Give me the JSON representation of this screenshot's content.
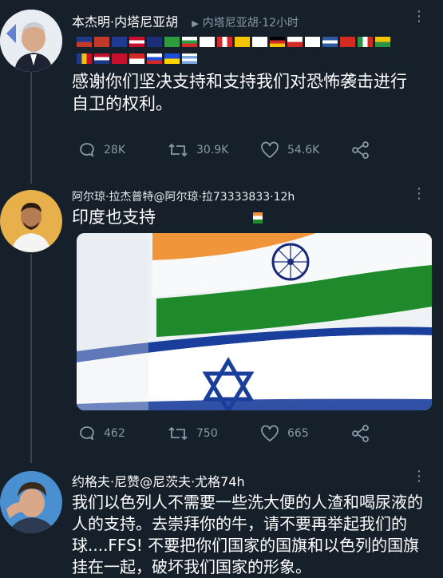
{
  "tweet1": {
    "name": "本杰明·内塔尼亚胡",
    "meta": "内塔尼亚胡·12小时",
    "flags_row1": [
      "#1d3a8a",
      "#c0392b",
      "#1f3a93",
      "#c8102e",
      "#1c2e7a",
      "#2e9b3f",
      "#ffffff",
      "#d62828",
      "#c8102e",
      "#f2c500",
      "#ffffff",
      "#1e3a8a",
      "#d62828",
      "#c8102e",
      "#ffffff",
      "#2d5aa0",
      "#d52b1e",
      "#2b9348",
      "#f2c500"
    ],
    "flags_row2": [
      "#f2c500",
      "#c8102e",
      "#c8102e",
      "#d62828",
      "#1d4ed8",
      "#ffd500",
      "#ffffff"
    ],
    "text": "感谢你们坚决支持和支持我们对恐怖袭击进行自卫的权利。",
    "replies": "28K",
    "retweets": "30.9K",
    "likes": "54.6K"
  },
  "tweet2": {
    "name": "阿尔琼·拉杰普特@阿尔琼·拉73333833·12h",
    "text": "印度也支持",
    "replies": "462",
    "retweets": "750",
    "likes": "665",
    "colors": {
      "saffron": "#f0953a",
      "green": "#1f8a2b",
      "chakra": "#1a2a7a",
      "israel_blue": "#1a3e9c"
    }
  },
  "tweet3": {
    "name": "约格夫·尼赞@尼茨夫·尤格74h",
    "text": "我们以色列人不需要一些洗大便的人渣和喝尿液的人的支持。去崇拜你的牛，请不要再举起我们的球....FFS! 不要把你们国家的国旗和以色列的国旗挂在一起，破坏我们国家的形象。"
  }
}
